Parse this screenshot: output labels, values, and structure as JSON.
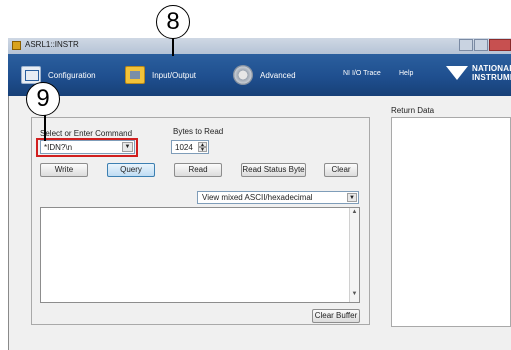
{
  "window": {
    "title": "ASRL1::INSTR"
  },
  "toolbar": {
    "configuration_label": "Configuration",
    "input_output_label": "Input/Output",
    "advanced_label": "Advanced",
    "ni_io_trace_label": "NI I/O Trace",
    "help_label": "Help",
    "logo_line1": "NATIONAL",
    "logo_line2": "INSTRUMENTS"
  },
  "command": {
    "label": "Select or Enter Command",
    "value": "*IDN?\\n",
    "bytes_label": "Bytes to Read",
    "bytes_value": "1024"
  },
  "buttons": {
    "write": "Write",
    "query": "Query",
    "read": "Read",
    "read_status_byte": "Read Status Byte",
    "clear": "Clear",
    "clear_buffer": "Clear Buffer"
  },
  "view_mode": {
    "selected": "View mixed ASCII/hexadecimal"
  },
  "return_data": {
    "label": "Return Data"
  },
  "callouts": {
    "input_output": "8",
    "command": "9"
  },
  "colors": {
    "toolbar": "#1f4f8f",
    "highlight": "#d11f1f"
  }
}
